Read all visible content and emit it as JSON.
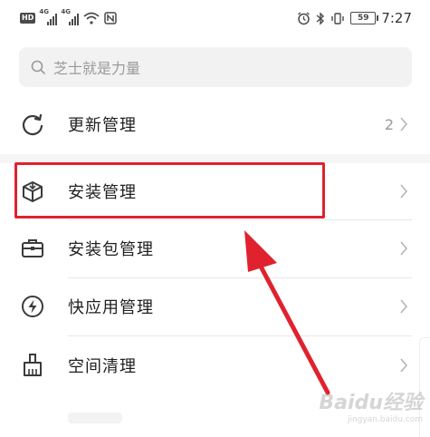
{
  "status_bar": {
    "hd_badge": "HD",
    "signal1_tag": "4G",
    "signal2_tag": "4G",
    "battery_level": "59",
    "time": "7:27"
  },
  "search": {
    "placeholder": "芝士就是力量"
  },
  "menu": {
    "items": [
      {
        "label": "更新管理",
        "count": "2",
        "icon": "refresh-icon"
      },
      {
        "label": "安装管理",
        "icon": "package-box-icon"
      },
      {
        "label": "安装包管理",
        "icon": "briefcase-icon"
      },
      {
        "label": "快应用管理",
        "icon": "lightning-icon"
      },
      {
        "label": "空间清理",
        "icon": "broom-icon"
      }
    ]
  },
  "annotation": {
    "highlight_color": "#e0222e",
    "highlighted_item": "安装管理"
  },
  "watermark": {
    "text": "Baidu经验",
    "subtext": "jingyan.baidu.com"
  }
}
